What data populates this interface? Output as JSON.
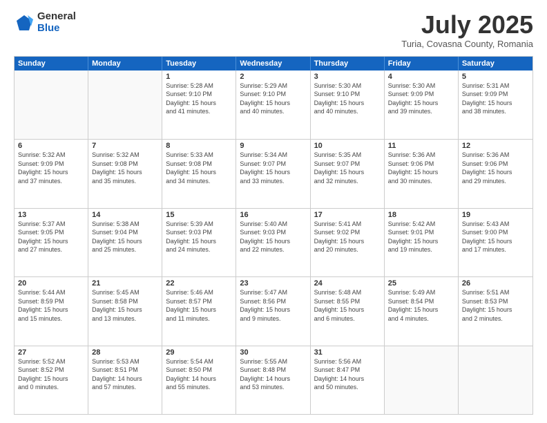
{
  "logo": {
    "general": "General",
    "blue": "Blue"
  },
  "header": {
    "month": "July 2025",
    "location": "Turia, Covasna County, Romania"
  },
  "weekdays": [
    "Sunday",
    "Monday",
    "Tuesday",
    "Wednesday",
    "Thursday",
    "Friday",
    "Saturday"
  ],
  "weeks": [
    [
      {
        "day": "",
        "info": "",
        "empty": true
      },
      {
        "day": "",
        "info": "",
        "empty": true
      },
      {
        "day": "1",
        "info": "Sunrise: 5:28 AM\nSunset: 9:10 PM\nDaylight: 15 hours\nand 41 minutes.",
        "empty": false
      },
      {
        "day": "2",
        "info": "Sunrise: 5:29 AM\nSunset: 9:10 PM\nDaylight: 15 hours\nand 40 minutes.",
        "empty": false
      },
      {
        "day": "3",
        "info": "Sunrise: 5:30 AM\nSunset: 9:10 PM\nDaylight: 15 hours\nand 40 minutes.",
        "empty": false
      },
      {
        "day": "4",
        "info": "Sunrise: 5:30 AM\nSunset: 9:09 PM\nDaylight: 15 hours\nand 39 minutes.",
        "empty": false
      },
      {
        "day": "5",
        "info": "Sunrise: 5:31 AM\nSunset: 9:09 PM\nDaylight: 15 hours\nand 38 minutes.",
        "empty": false
      }
    ],
    [
      {
        "day": "6",
        "info": "Sunrise: 5:32 AM\nSunset: 9:09 PM\nDaylight: 15 hours\nand 37 minutes.",
        "empty": false
      },
      {
        "day": "7",
        "info": "Sunrise: 5:32 AM\nSunset: 9:08 PM\nDaylight: 15 hours\nand 35 minutes.",
        "empty": false
      },
      {
        "day": "8",
        "info": "Sunrise: 5:33 AM\nSunset: 9:08 PM\nDaylight: 15 hours\nand 34 minutes.",
        "empty": false
      },
      {
        "day": "9",
        "info": "Sunrise: 5:34 AM\nSunset: 9:07 PM\nDaylight: 15 hours\nand 33 minutes.",
        "empty": false
      },
      {
        "day": "10",
        "info": "Sunrise: 5:35 AM\nSunset: 9:07 PM\nDaylight: 15 hours\nand 32 minutes.",
        "empty": false
      },
      {
        "day": "11",
        "info": "Sunrise: 5:36 AM\nSunset: 9:06 PM\nDaylight: 15 hours\nand 30 minutes.",
        "empty": false
      },
      {
        "day": "12",
        "info": "Sunrise: 5:36 AM\nSunset: 9:06 PM\nDaylight: 15 hours\nand 29 minutes.",
        "empty": false
      }
    ],
    [
      {
        "day": "13",
        "info": "Sunrise: 5:37 AM\nSunset: 9:05 PM\nDaylight: 15 hours\nand 27 minutes.",
        "empty": false
      },
      {
        "day": "14",
        "info": "Sunrise: 5:38 AM\nSunset: 9:04 PM\nDaylight: 15 hours\nand 25 minutes.",
        "empty": false
      },
      {
        "day": "15",
        "info": "Sunrise: 5:39 AM\nSunset: 9:03 PM\nDaylight: 15 hours\nand 24 minutes.",
        "empty": false
      },
      {
        "day": "16",
        "info": "Sunrise: 5:40 AM\nSunset: 9:03 PM\nDaylight: 15 hours\nand 22 minutes.",
        "empty": false
      },
      {
        "day": "17",
        "info": "Sunrise: 5:41 AM\nSunset: 9:02 PM\nDaylight: 15 hours\nand 20 minutes.",
        "empty": false
      },
      {
        "day": "18",
        "info": "Sunrise: 5:42 AM\nSunset: 9:01 PM\nDaylight: 15 hours\nand 19 minutes.",
        "empty": false
      },
      {
        "day": "19",
        "info": "Sunrise: 5:43 AM\nSunset: 9:00 PM\nDaylight: 15 hours\nand 17 minutes.",
        "empty": false
      }
    ],
    [
      {
        "day": "20",
        "info": "Sunrise: 5:44 AM\nSunset: 8:59 PM\nDaylight: 15 hours\nand 15 minutes.",
        "empty": false
      },
      {
        "day": "21",
        "info": "Sunrise: 5:45 AM\nSunset: 8:58 PM\nDaylight: 15 hours\nand 13 minutes.",
        "empty": false
      },
      {
        "day": "22",
        "info": "Sunrise: 5:46 AM\nSunset: 8:57 PM\nDaylight: 15 hours\nand 11 minutes.",
        "empty": false
      },
      {
        "day": "23",
        "info": "Sunrise: 5:47 AM\nSunset: 8:56 PM\nDaylight: 15 hours\nand 9 minutes.",
        "empty": false
      },
      {
        "day": "24",
        "info": "Sunrise: 5:48 AM\nSunset: 8:55 PM\nDaylight: 15 hours\nand 6 minutes.",
        "empty": false
      },
      {
        "day": "25",
        "info": "Sunrise: 5:49 AM\nSunset: 8:54 PM\nDaylight: 15 hours\nand 4 minutes.",
        "empty": false
      },
      {
        "day": "26",
        "info": "Sunrise: 5:51 AM\nSunset: 8:53 PM\nDaylight: 15 hours\nand 2 minutes.",
        "empty": false
      }
    ],
    [
      {
        "day": "27",
        "info": "Sunrise: 5:52 AM\nSunset: 8:52 PM\nDaylight: 15 hours\nand 0 minutes.",
        "empty": false
      },
      {
        "day": "28",
        "info": "Sunrise: 5:53 AM\nSunset: 8:51 PM\nDaylight: 14 hours\nand 57 minutes.",
        "empty": false
      },
      {
        "day": "29",
        "info": "Sunrise: 5:54 AM\nSunset: 8:50 PM\nDaylight: 14 hours\nand 55 minutes.",
        "empty": false
      },
      {
        "day": "30",
        "info": "Sunrise: 5:55 AM\nSunset: 8:48 PM\nDaylight: 14 hours\nand 53 minutes.",
        "empty": false
      },
      {
        "day": "31",
        "info": "Sunrise: 5:56 AM\nSunset: 8:47 PM\nDaylight: 14 hours\nand 50 minutes.",
        "empty": false
      },
      {
        "day": "",
        "info": "",
        "empty": true
      },
      {
        "day": "",
        "info": "",
        "empty": true
      }
    ]
  ]
}
